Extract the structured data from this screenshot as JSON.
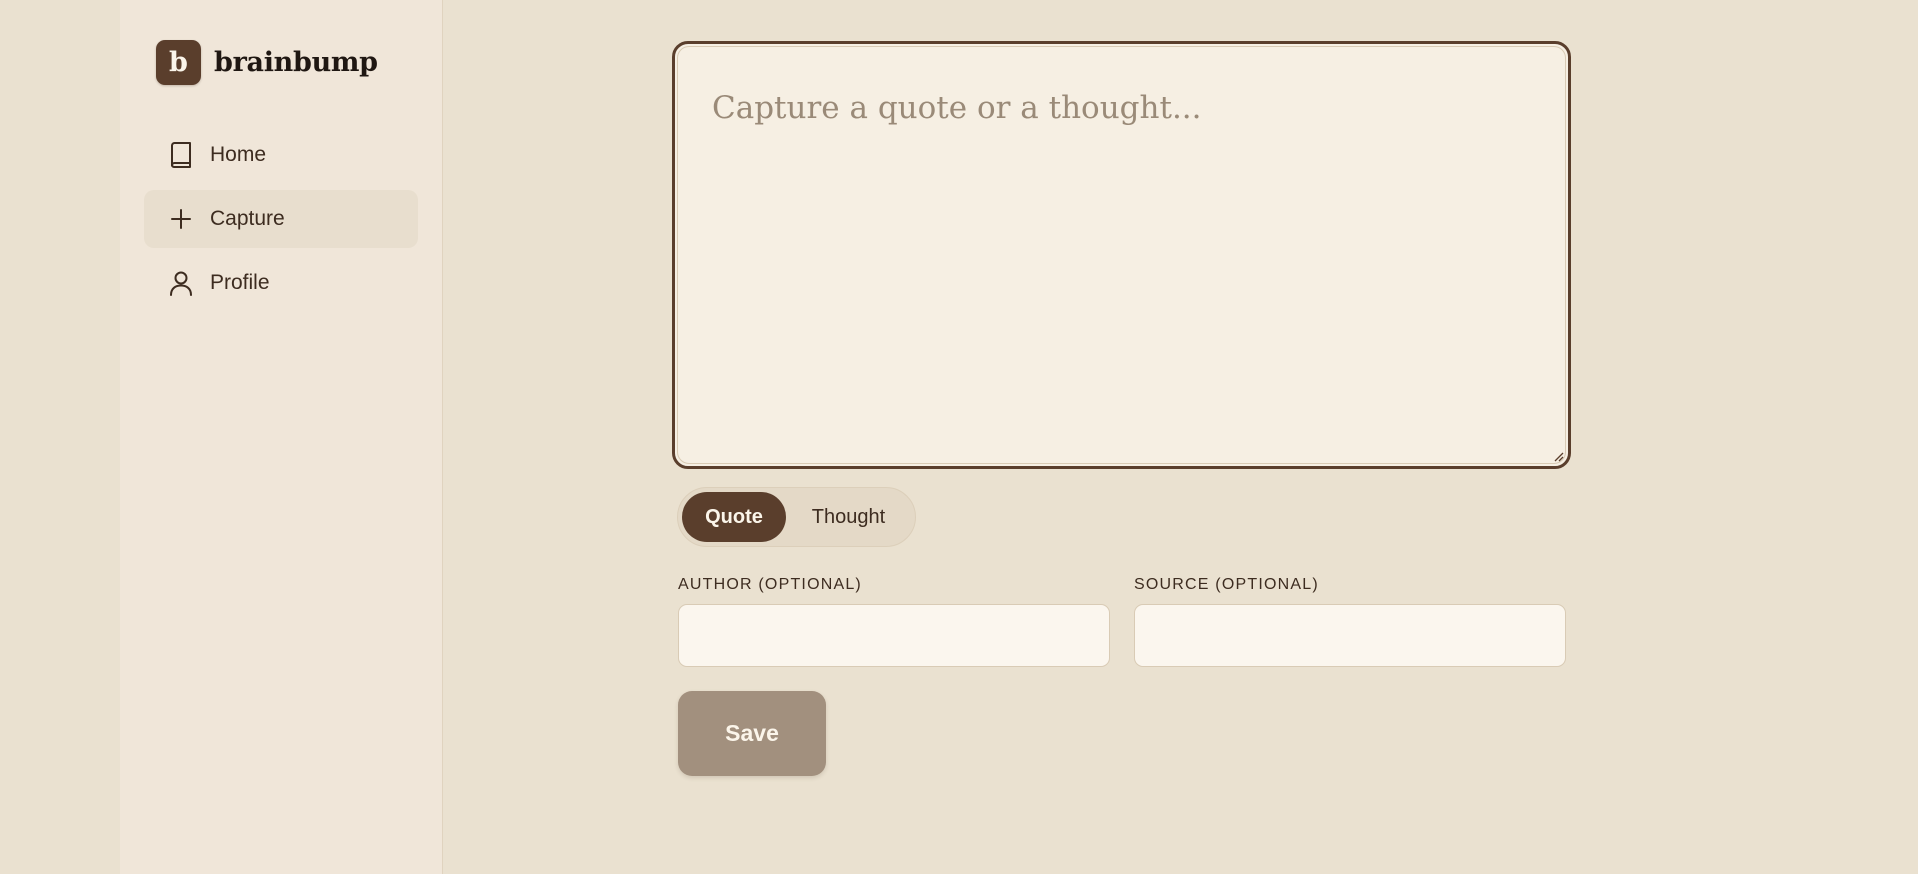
{
  "app": {
    "logo_letter": "b",
    "name": "brainbump"
  },
  "sidebar": {
    "items": [
      {
        "label": "Home",
        "icon": "book-icon",
        "active": false
      },
      {
        "label": "Capture",
        "icon": "plus-icon",
        "active": true
      },
      {
        "label": "Profile",
        "icon": "user-icon",
        "active": false
      }
    ]
  },
  "editor": {
    "placeholder": "Capture a quote or a thought...",
    "value": ""
  },
  "entry_type": {
    "options": [
      "Quote",
      "Thought"
    ],
    "selected": "Quote"
  },
  "fields": {
    "author_label": "AUTHOR (OPTIONAL)",
    "author_value": "",
    "source_label": "SOURCE (OPTIONAL)",
    "source_value": ""
  },
  "actions": {
    "save_label": "Save"
  },
  "colors": {
    "background": "#eae1d0",
    "sidebar": "#f0e6d9",
    "accent": "#5a3e2c",
    "save_disabled": "#a2907e"
  }
}
